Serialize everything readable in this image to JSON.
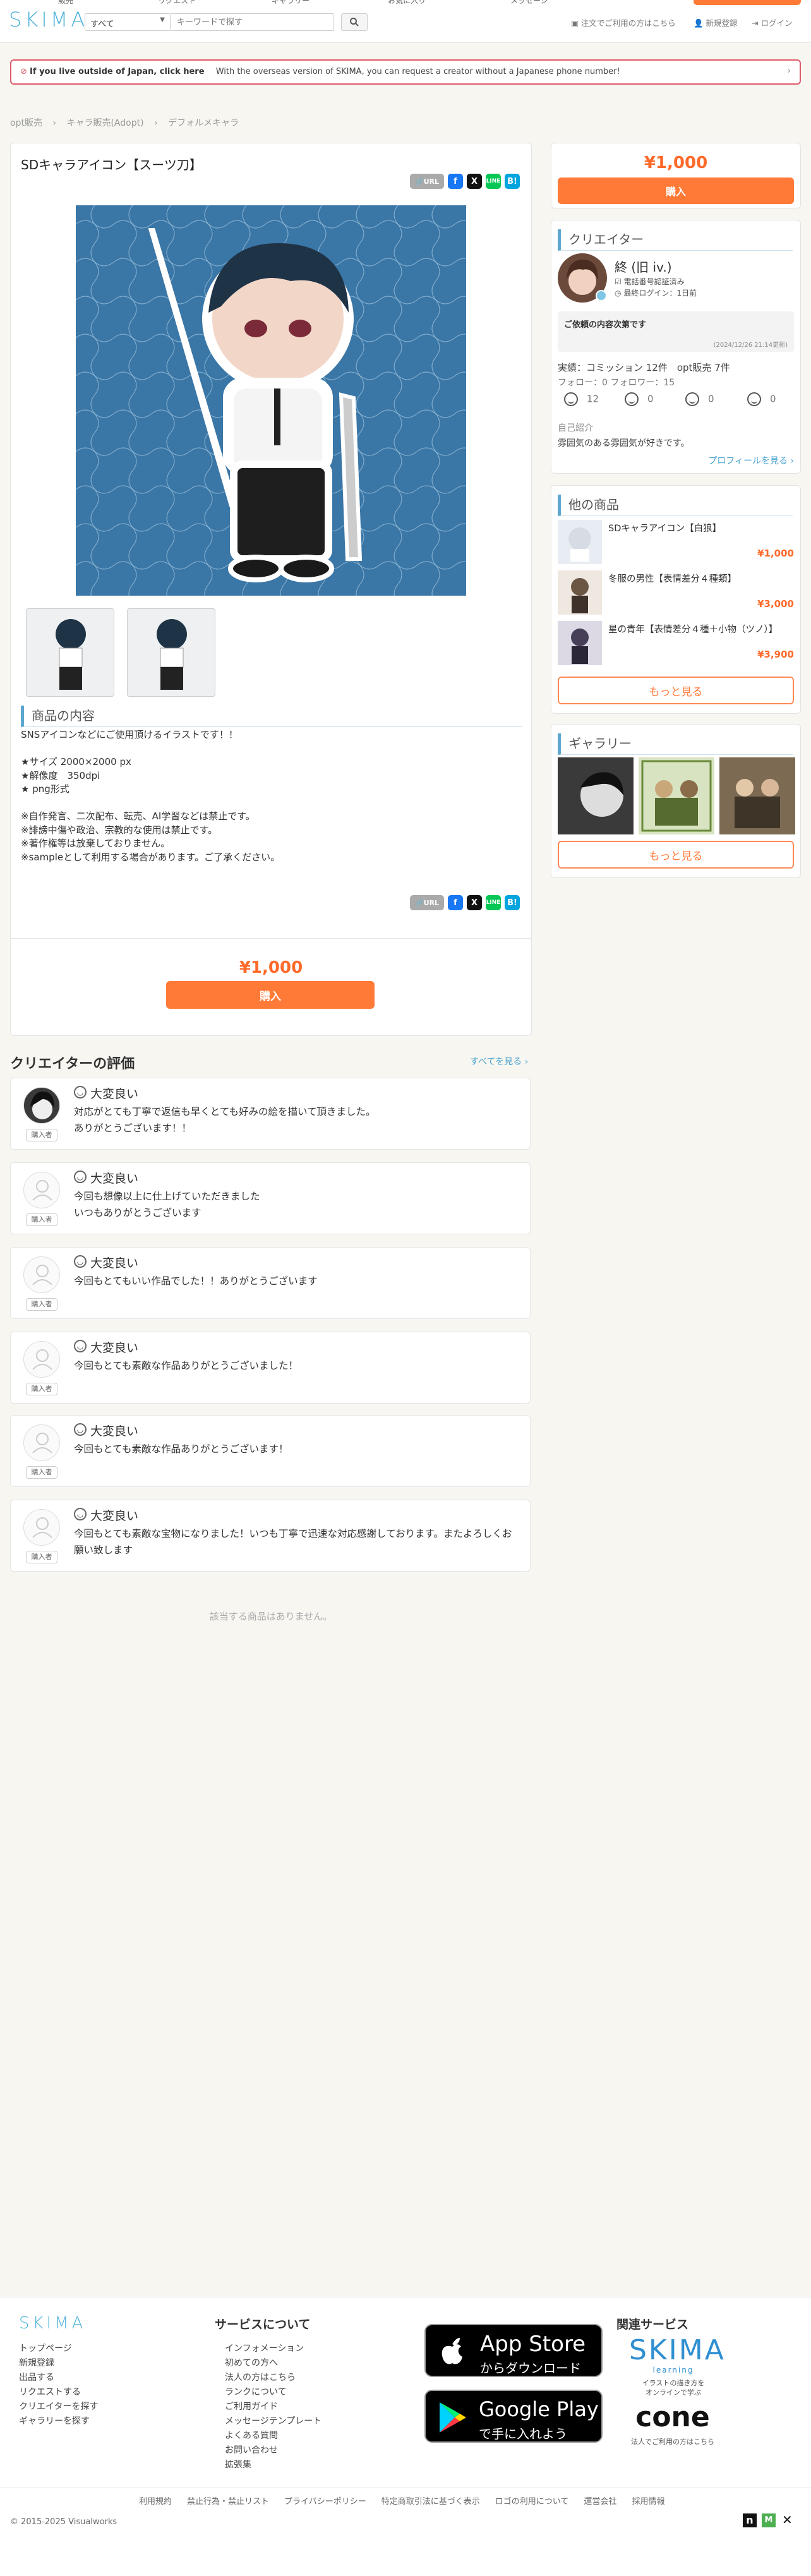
{
  "header": {
    "top_tabs": [
      "販売",
      "リクエスト",
      "ギャラリー",
      "お気に入り",
      "メッセージ"
    ],
    "logo": "SKIMA",
    "search_select": "すべて",
    "search_placeholder": "キーワードで探す",
    "links": [
      "注文でご利用の方はこちら",
      "新規登録",
      "ログイン"
    ]
  },
  "banner": {
    "bold": "If you live outside of Japan, click here",
    "text": "With the overseas version of SKIMA, you can request a creator without a Japanese phone number!"
  },
  "breadcrumb": [
    "opt販売",
    "キャラ販売(Adopt)",
    "デフォルメキャラ"
  ],
  "product": {
    "title": "SDキャラアイコン【スーツ刀】",
    "url_label": "URL",
    "desc_heading": "商品の内容",
    "description": "SNSアイコンなどにご使用頂けるイラストです！！\n\n★サイズ 2000×2000 px\n★解像度　350dpi\n★ png形式\n\n※自作発言、二次配布、転売、AI学習などは禁止です。\n※誹謗中傷や政治、宗教的な使用は禁止です。\n※著作権等は放棄しておりません。\n※sampleとして利用する場合があります。ご了承ください。",
    "price": "¥1,000",
    "buy_label": "購入"
  },
  "sidebar": {
    "price": "¥1,000",
    "buy_label": "購入",
    "creator_heading": "クリエイター",
    "creator_name": "終 (旧 iv.)",
    "verified": "電話番号認証済み",
    "last_login": "最終ログイン：1日前",
    "status_title": "ご依頼の内容次第です",
    "status_date": "(2024/12/26 21:14更新)",
    "stats_line": "実績：コミッション 12件　opt販売 7件",
    "follow_line": "フォロー：0 フォロワー：15",
    "ratings": [
      "12",
      "0",
      "0",
      "0"
    ],
    "intro_label": "自己紹介",
    "intro_text": "雰囲気のある雰囲気が好きです。",
    "profile_link": "プロフィールを見る ›",
    "other_heading": "他の商品",
    "other_items": [
      {
        "name": "SDキャラアイコン【白狼】",
        "price": "¥1,000"
      },
      {
        "name": "冬服の男性【表情差分４種類】",
        "price": "¥3,000"
      },
      {
        "name": "星の青年【表情差分４種＋小物（ツノ）】",
        "price": "¥3,900"
      }
    ],
    "more_label": "もっと見る",
    "gallery_heading": "ギャラリー",
    "gallery_more": "もっと見る"
  },
  "reviews": {
    "heading": "クリエイターの評価",
    "see_all": "すべてを見る ›",
    "badge": "購入者",
    "items": [
      {
        "label": "大変良い",
        "text": "対応がとても丁寧で返信も早くとても好みの絵を描いて頂きました。\nありがとうございます！！"
      },
      {
        "label": "大変良い",
        "text": "今回も想像以上に仕上げていただきました\nいつもありがとうございます"
      },
      {
        "label": "大変良い",
        "text": "今回もとてもいい作品でした！！ありがとうございます"
      },
      {
        "label": "大変良い",
        "text": "今回もとても素敵な作品ありがとうございました！"
      },
      {
        "label": "大変良い",
        "text": "今回もとても素敵な作品ありがとうございます！"
      },
      {
        "label": "大変良い",
        "text": "今回もとても素敵な宝物になりました！いつも丁寧で迅速な対応感謝しております。またよろしくお願い致します"
      }
    ],
    "empty_related": "該当する商品はありません。"
  },
  "footer": {
    "logo": "SKIMA",
    "col1": [
      "トップページ",
      "新規登録",
      "出品する",
      "リクエストする",
      "クリエイターを探す",
      "ギャラリーを探す"
    ],
    "service_heading": "サービスについて",
    "col2": [
      "インフォメーション",
      "初めての方へ",
      "法人の方はこちら",
      "ランクについて",
      "ご利用ガイド",
      "メッセージテンプレート",
      "よくある質問",
      "お問い合わせ",
      "拡張集"
    ],
    "appstore_top": "App Store",
    "appstore_bottom": "からダウンロード",
    "gplay_top": "Google Play",
    "gplay_bottom": "で手に入れよう",
    "related_heading": "関連サービス",
    "learning_logo": "SKIMA",
    "learning_sub": "learning",
    "learning_desc": "イラストの描き方を\nオンラインで学ぶ",
    "cone_logo": "cone",
    "cone_desc": "法人でご利用の方はこちら",
    "bottom_links": [
      "利用規約",
      "禁止行為・禁止リスト",
      "プライバシーポリシー",
      "特定商取引法に基づく表示",
      "ロゴの利用について",
      "運営会社",
      "採用情報"
    ],
    "copyright": "© 2015-2025 Visualworks"
  }
}
